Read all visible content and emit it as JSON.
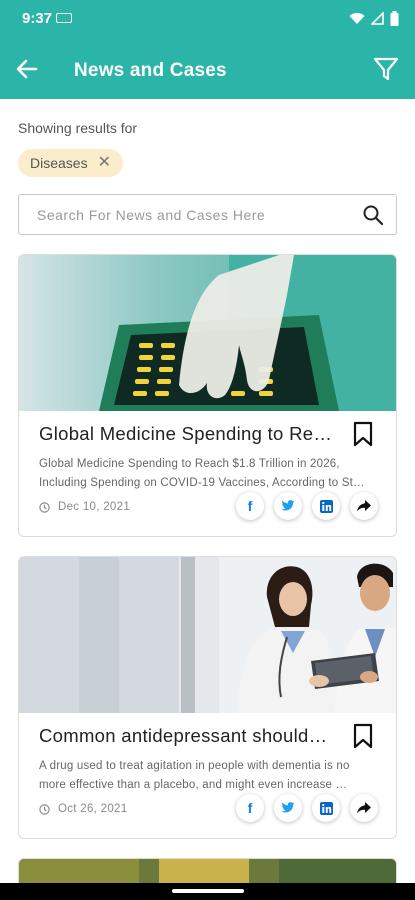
{
  "status_bar": {
    "time": "9:37"
  },
  "header": {
    "title": "News and Cases"
  },
  "filters": {
    "label": "Showing results for",
    "chips": [
      {
        "label": "Diseases"
      }
    ]
  },
  "search": {
    "placeholder": "Search For News and Cases Here"
  },
  "articles": [
    {
      "title": "Global Medicine Spending to Re…",
      "description": "Global Medicine Spending to Reach $1.8 Trillion in 2026, Including Spending on COVID-19 Vaccines, According to St…",
      "date": "Dec 10, 2021"
    },
    {
      "title": "Common antidepressant should…",
      "description": "A drug used to treat agitation in people with dementia is no more effective than a placebo, and might even increase …",
      "date": "Oct 26, 2021"
    }
  ],
  "colors": {
    "accent": "#2bb5a8",
    "chip_bg": "#fbeccb",
    "facebook": "#1877f2",
    "twitter": "#1da1f2",
    "linkedin": "#0a66c2"
  }
}
